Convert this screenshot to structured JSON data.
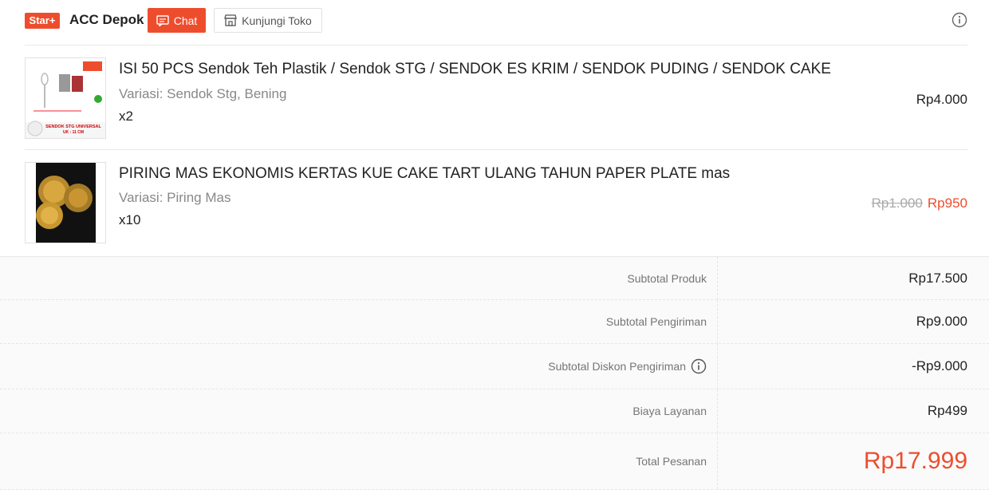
{
  "shop": {
    "badge": "Star+",
    "name": "ACC Depok",
    "chat_label": "Chat",
    "visit_label": "Kunjungi Toko"
  },
  "products": [
    {
      "name": "ISI 50 PCS Sendok Teh Plastik / Sendok STG / SENDOK ES KRIM / SENDOK PUDING / SENDOK CAKE",
      "variant": "Variasi: Sendok Stg, Bening",
      "qty": "x2",
      "price": "Rp4.000",
      "thumb_text": "SENDOK STG UNIVERSAL",
      "thumb_sub": "UK : 11 CM"
    },
    {
      "name": "PIRING MAS EKONOMIS KERTAS KUE CAKE TART ULANG TAHUN PAPER PLATE mas",
      "variant": "Variasi: Piring Mas",
      "qty": "x10",
      "original_price": "Rp1.000",
      "price": "Rp950"
    }
  ],
  "summary": [
    {
      "label": "Subtotal Produk",
      "value": "Rp17.500"
    },
    {
      "label": "Subtotal Pengiriman",
      "value": "Rp9.000"
    },
    {
      "label": "Subtotal Diskon Pengiriman",
      "value": "-Rp9.000",
      "info_icon": "info-icon"
    },
    {
      "label": "Biaya Layanan",
      "value": "Rp499"
    },
    {
      "label": "Total Pesanan",
      "value": "Rp17.999"
    }
  ],
  "colors": {
    "accent": "#ee4d2d",
    "muted": "#757575"
  }
}
